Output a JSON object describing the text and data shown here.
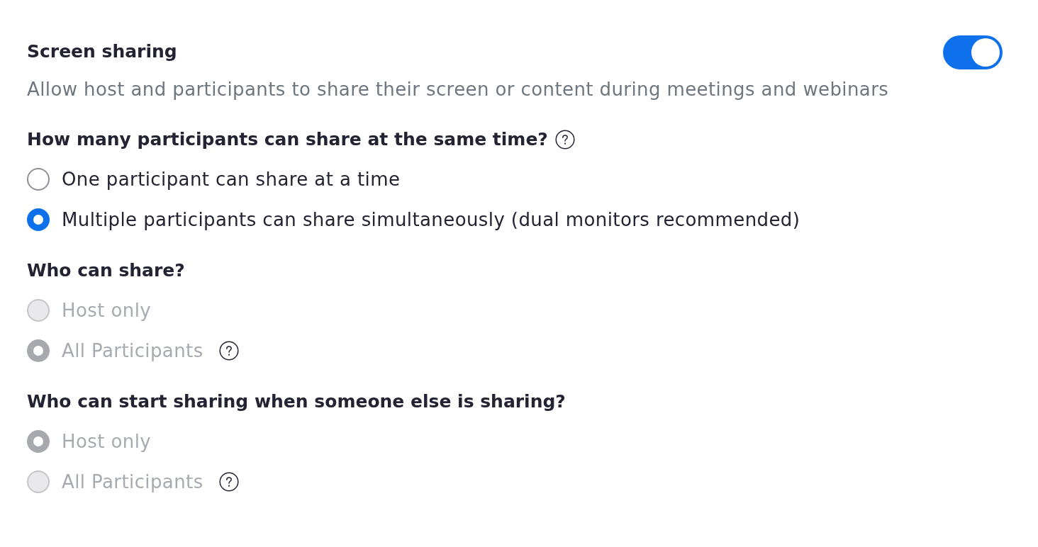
{
  "setting": {
    "title": "Screen sharing",
    "description": "Allow host and participants to share their screen or content during meetings and webinars",
    "enabled": true
  },
  "groups": [
    {
      "question": "How many participants can share at the same time?",
      "help": true,
      "options": [
        {
          "label": "One participant can share at a time",
          "selected": false,
          "disabled": false,
          "help": false
        },
        {
          "label": "Multiple participants can share simultaneously (dual monitors recommended)",
          "selected": true,
          "disabled": false,
          "help": false
        }
      ]
    },
    {
      "question": "Who can share?",
      "help": false,
      "options": [
        {
          "label": "Host only",
          "selected": false,
          "disabled": true,
          "help": false
        },
        {
          "label": "All Participants",
          "selected": true,
          "disabled": true,
          "help": true
        }
      ]
    },
    {
      "question": "Who can start sharing when someone else is sharing?",
      "help": false,
      "options": [
        {
          "label": "Host only",
          "selected": true,
          "disabled": true,
          "help": false
        },
        {
          "label": "All Participants",
          "selected": false,
          "disabled": true,
          "help": true
        }
      ]
    }
  ]
}
